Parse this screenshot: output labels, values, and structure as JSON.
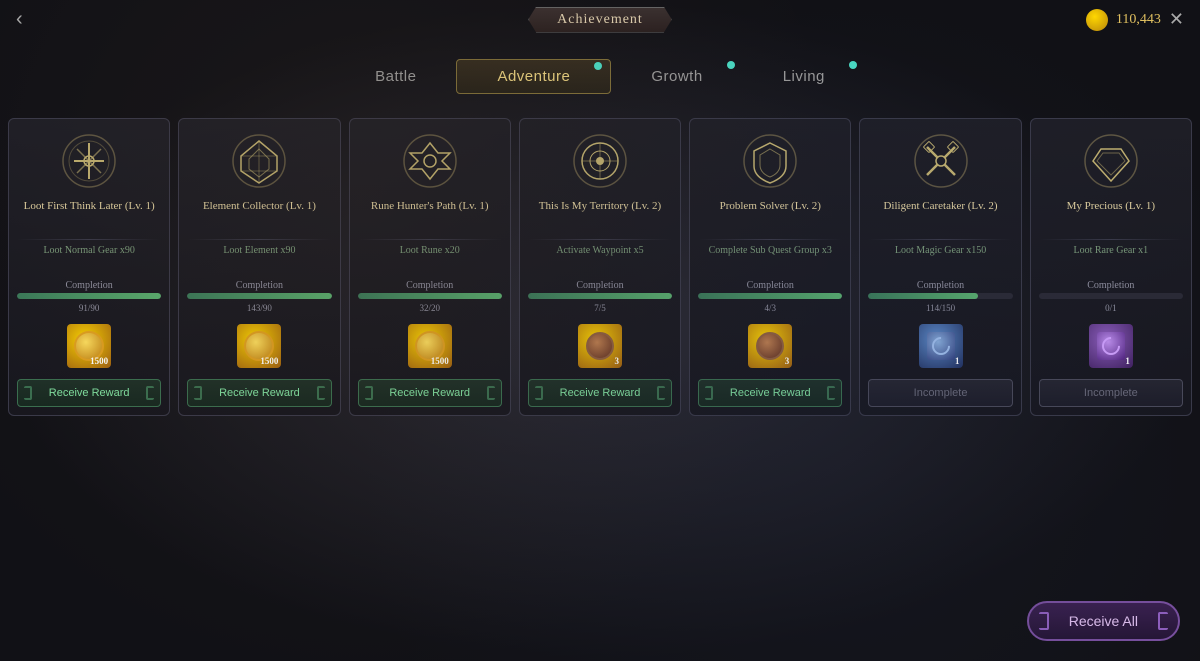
{
  "header": {
    "title": "Achievement",
    "back_label": "‹",
    "close_label": "✕",
    "currency_amount": "110,443"
  },
  "tabs": [
    {
      "id": "battle",
      "label": "Battle",
      "active": false,
      "dot": false
    },
    {
      "id": "adventure",
      "label": "Adventure",
      "active": true,
      "dot": true
    },
    {
      "id": "growth",
      "label": "Growth",
      "active": false,
      "dot": true
    },
    {
      "id": "living",
      "label": "Living",
      "active": false,
      "dot": true
    }
  ],
  "cards": [
    {
      "title": "Loot First Think Later (Lv. 1)",
      "task": "Loot Normal Gear x90",
      "completion_label": "Completion",
      "progress_current": 91,
      "progress_max": 90,
      "progress_text": "91/90",
      "progress_pct": 100,
      "reward_type": "gold",
      "reward_count": "1500",
      "button_type": "receive",
      "button_label": "Receive Reward"
    },
    {
      "title": "Element Collector (Lv. 1)",
      "task": "Loot Element x90",
      "completion_label": "Completion",
      "progress_current": 143,
      "progress_max": 90,
      "progress_text": "143/90",
      "progress_pct": 100,
      "reward_type": "gold",
      "reward_count": "1500",
      "button_type": "receive",
      "button_label": "Receive Reward"
    },
    {
      "title": "Rune Hunter's Path (Lv. 1)",
      "task": "Loot Rune x20",
      "completion_label": "Completion",
      "progress_current": 32,
      "progress_max": 20,
      "progress_text": "32/20",
      "progress_pct": 100,
      "reward_type": "gold",
      "reward_count": "1500",
      "button_type": "receive",
      "button_label": "Receive Reward"
    },
    {
      "title": "This Is My Territory (Lv. 2)",
      "task": "Activate Waypoint x5",
      "completion_label": "Completion",
      "progress_current": 7,
      "progress_max": 5,
      "progress_text": "7/5",
      "progress_pct": 100,
      "reward_type": "brown",
      "reward_count": "3",
      "button_type": "receive",
      "button_label": "Receive Reward"
    },
    {
      "title": "Problem Solver (Lv. 2)",
      "task": "Complete Sub Quest Group x3",
      "completion_label": "Completion",
      "progress_current": 4,
      "progress_max": 3,
      "progress_text": "4/3",
      "progress_pct": 100,
      "reward_type": "brown",
      "reward_count": "3",
      "button_type": "receive",
      "button_label": "Receive Reward"
    },
    {
      "title": "Diligent Caretaker (Lv. 2)",
      "task": "Loot Magic Gear x150",
      "completion_label": "Completion",
      "progress_current": 114,
      "progress_max": 150,
      "progress_text": "114/150",
      "progress_pct": 76,
      "reward_type": "blue",
      "reward_count": "1",
      "button_type": "incomplete",
      "button_label": "Incomplete"
    },
    {
      "title": "My Precious (Lv. 1)",
      "task": "Loot Rare Gear x1",
      "completion_label": "Completion",
      "progress_current": 0,
      "progress_max": 1,
      "progress_text": "0/1",
      "progress_pct": 0,
      "reward_type": "purple",
      "reward_count": "1",
      "button_type": "incomplete",
      "button_label": "Incomplete"
    }
  ],
  "bottom": {
    "receive_all_label": "Receive All"
  }
}
